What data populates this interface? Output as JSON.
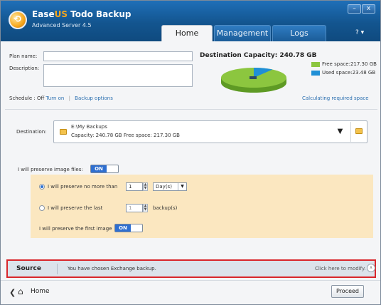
{
  "app": {
    "title_main": "Ease",
    "title_us": "US",
    "title_rest": " Todo Backup",
    "subtitle": "Advanced Server 4.5",
    "minimize": "–",
    "close": "x",
    "help": "? ▾"
  },
  "tabs": [
    {
      "label": "Home",
      "active": true
    },
    {
      "label": "Management",
      "active": false
    },
    {
      "label": "Logs",
      "active": false
    }
  ],
  "plan": {
    "plan_name_label": "Plan name:",
    "plan_name_value": "",
    "description_label": "Description:",
    "description_value": "",
    "schedule_text": "Schedule : Off",
    "turn_on_link": "Turn on",
    "separator": "|",
    "backup_options_link": "Backup options"
  },
  "capacity": {
    "title": "Destination Capacity: 240.78 GB",
    "free_label": "Free space:217.30 GB",
    "used_label": "Used space:23.48 GB",
    "free_fraction": 0.9025,
    "used_fraction": 0.0975,
    "free_color": "#8cc63f",
    "used_color": "#1f8fd6",
    "calculating_link": "Calculating required space"
  },
  "destination": {
    "label": "Destination:",
    "path": "E:\\My Backups",
    "details": "Capacity: 240.78 GB  Free space: 217.30 GB",
    "dropdown_icon": "▼"
  },
  "preserve": {
    "label": "I will preserve image files:",
    "toggle_on": "ON",
    "option1_label": "I will preserve no more than",
    "option1_value": "1",
    "option1_unit": "Day(s)",
    "option2_label": "I will preserve the last",
    "option2_value": "1",
    "option2_unit": "backup(s)",
    "first_image_label": "I will preserve the first image",
    "first_image_toggle": "ON"
  },
  "source": {
    "title": "Source",
    "message": "You have chosen Exchange backup.",
    "modify_link": "Click here to modify.",
    "chevron": "∧"
  },
  "footer": {
    "back_arrow": "❮",
    "home_icon": "⌂",
    "home_label": "Home",
    "proceed_label": "Proceed"
  }
}
